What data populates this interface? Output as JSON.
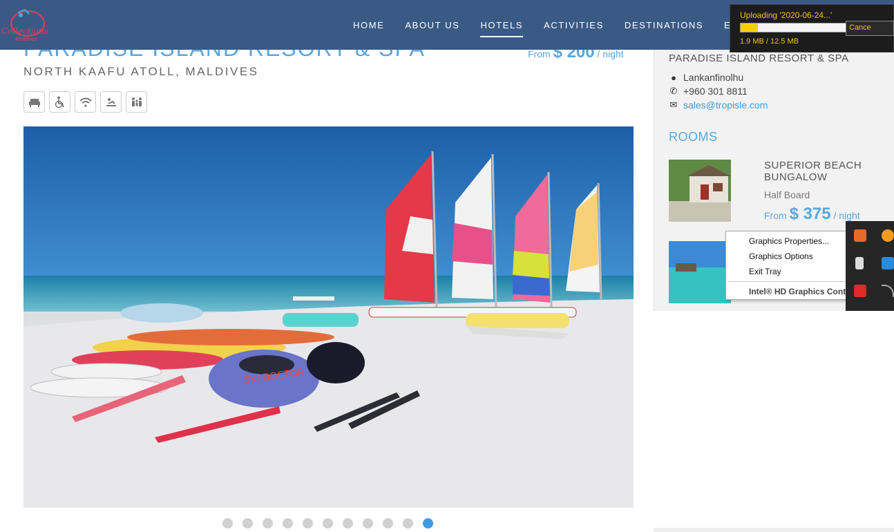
{
  "logo": {
    "text": "Collections",
    "sub": "Maldives"
  },
  "nav": {
    "items": [
      {
        "label": "HOME"
      },
      {
        "label": "ABOUT US"
      },
      {
        "label": "HOTELS",
        "active": true
      },
      {
        "label": "ACTIVITIES"
      },
      {
        "label": "DESTINATIONS"
      },
      {
        "label": "E"
      }
    ]
  },
  "upload": {
    "title": "Uploading '2020-06-24...'",
    "size": "1.9 MB / 12.5 MB",
    "progress": 0.15,
    "cancel": "Cance"
  },
  "hotel": {
    "title": "PARADISE ISLAND RESORT & SPA",
    "location": "NORTH KAAFU ATOLL, MALDIVES",
    "price_prefix": "From",
    "price": "$ 200",
    "price_suffix": "/ night",
    "amenities": [
      "armchair-icon",
      "wheelchair-icon",
      "wifi-icon",
      "massage-icon",
      "family-icon"
    ]
  },
  "carousel": {
    "count": 11,
    "active": 10
  },
  "sidebar": {
    "title": "PARADISE ISLAND RESORT & SPA",
    "address": "Lankanfinolhu",
    "phone": "+960 301 8811",
    "email": "sales@tropisle.com",
    "rooms_title": "ROOMS",
    "room": {
      "name_line1": "SUPERIOR BEACH",
      "name_line2": "BUNGALOW",
      "board": "Half Board",
      "price_prefix": "From",
      "price": "$ 375",
      "price_suffix": "/ night"
    }
  },
  "context_menu": {
    "items": [
      "Graphics Properties...",
      "Graphics Options",
      "Exit Tray"
    ],
    "footer": "Intel® HD Graphics Contr"
  },
  "colors": {
    "nav_bg": "#3a5a86",
    "accent": "#5aa6dc",
    "link": "#3d9ce0"
  }
}
